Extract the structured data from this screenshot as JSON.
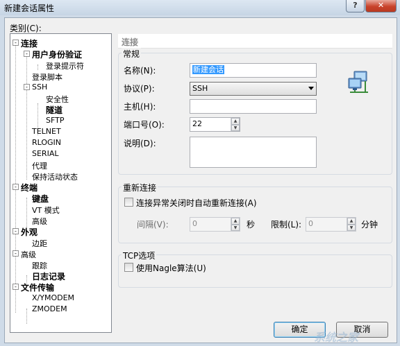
{
  "window": {
    "title": "新建会话属性",
    "help": "?",
    "close": "✕"
  },
  "category_label": "类别(C):",
  "tree": {
    "connection": "连接",
    "auth": "用户身份验证",
    "login_prompt": "登录提示符",
    "login_script": "登录脚本",
    "ssh": "SSH",
    "security": "安全性",
    "tunnel": "隧道",
    "sftp": "SFTP",
    "telnet": "TELNET",
    "rlogin": "RLOGIN",
    "serial": "SERIAL",
    "proxy": "代理",
    "keepalive": "保持活动状态",
    "terminal": "终端",
    "keyboard": "键盘",
    "vt_mode": "VT 模式",
    "advanced1": "高级",
    "appearance": "外观",
    "margin": "边距",
    "advanced2": "高级",
    "trace": "跟踪",
    "log": "日志记录",
    "file_transfer": "文件传输",
    "xymodem": "X/YMODEM",
    "zmodem": "ZMODEM",
    "expanded_sign": "-"
  },
  "panel": {
    "header": "连接",
    "general": {
      "title": "常规",
      "name_label": "名称(N):",
      "name_value": "新建会话",
      "protocol_label": "协议(P):",
      "protocol_value": "SSH",
      "host_label": "主机(H):",
      "host_value": "",
      "port_label": "端口号(O):",
      "port_value": "22",
      "desc_label": "说明(D):",
      "desc_value": ""
    },
    "reconnect": {
      "title": "重新连接",
      "checkbox_label": "连接异常关闭时自动重新连接(A)",
      "interval_label": "间隔(V):",
      "interval_value": "0",
      "sec_unit": "秒",
      "limit_label": "限制(L):",
      "limit_value": "0",
      "min_unit": "分钟"
    },
    "tcp": {
      "title": "TCP选项",
      "nagle_label": "使用Nagle算法(U)"
    }
  },
  "buttons": {
    "ok": "确定",
    "cancel": "取消"
  },
  "spin": {
    "up": "▲",
    "down": "▼"
  },
  "watermark": "系统之家"
}
